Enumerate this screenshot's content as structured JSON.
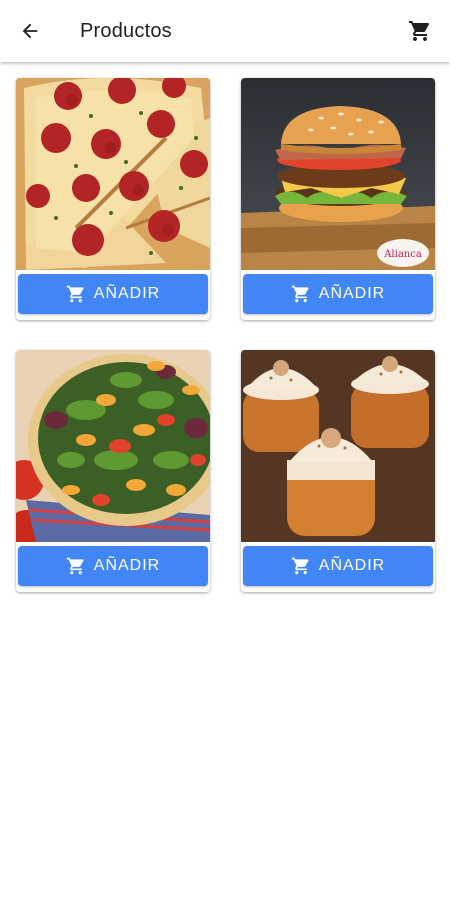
{
  "appbar": {
    "title": "Productos",
    "back_icon": "arrow-back-icon",
    "cart_icon": "shopping-cart-icon"
  },
  "products": [
    {
      "name": "pizza",
      "button_label": "AÑADIR"
    },
    {
      "name": "hamburguesa",
      "button_label": "AÑADIR",
      "badge_text": "Alianca"
    },
    {
      "name": "ensalada",
      "button_label": "AÑADIR"
    },
    {
      "name": "postre",
      "button_label": "AÑADIR"
    }
  ],
  "colors": {
    "accent": "#4285f4",
    "appbar_bg": "#ffffff",
    "text": "#212121"
  }
}
